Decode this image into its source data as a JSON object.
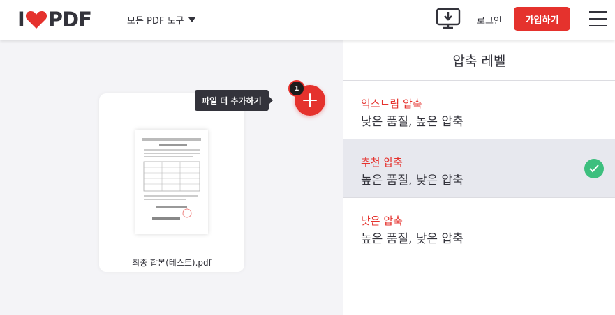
{
  "header": {
    "logo_left": "I",
    "logo_right": "PDF",
    "tools_menu": "모든 PDF 도구",
    "login": "로그인",
    "signup": "가입하기",
    "brand_color": "#e5322d"
  },
  "workspace": {
    "file_name": "최종 합본(테스트).pdf",
    "tooltip": "파일 더 추가하기",
    "file_count": "1"
  },
  "panel": {
    "title": "압축 레벨",
    "options": [
      {
        "title": "익스트림 압축",
        "desc": "낮은 품질, 높은 압축",
        "selected": false
      },
      {
        "title": "추천 압축",
        "desc": "높은 품질, 낮은 압축",
        "selected": true
      },
      {
        "title": "낮은 압축",
        "desc": "높은 품질, 낮은 압축",
        "selected": false
      }
    ]
  }
}
